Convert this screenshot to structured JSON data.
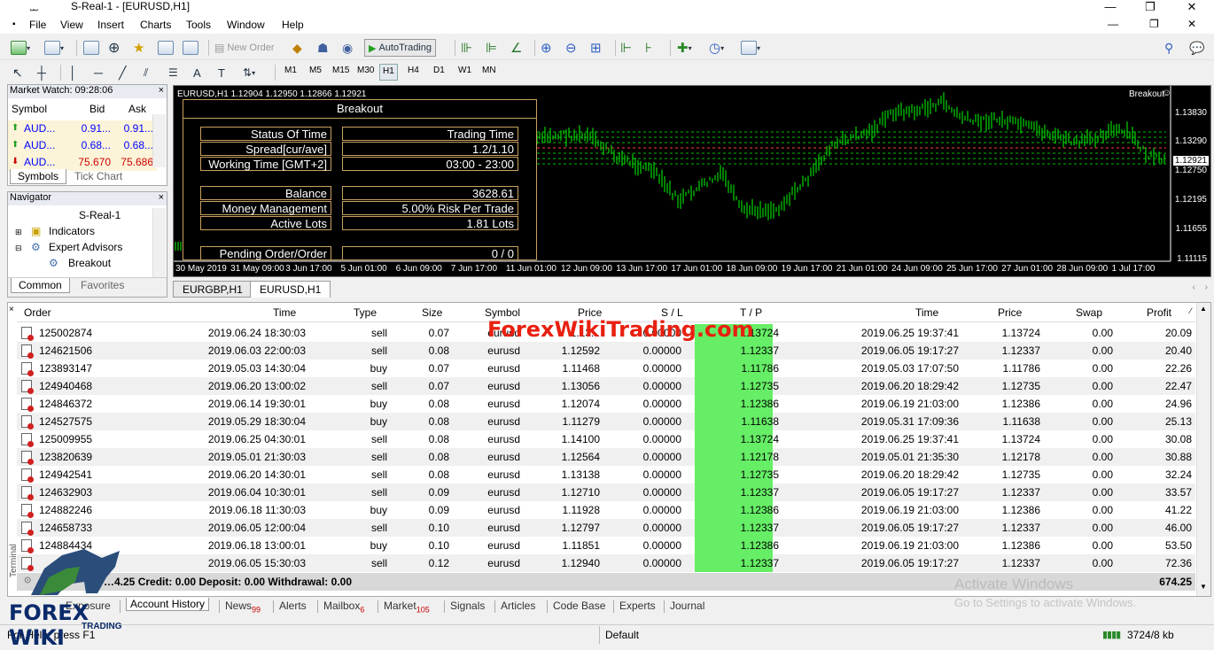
{
  "window": {
    "title": "S-Real-1 - [EURUSD,H1]",
    "icon": "mt4-icon",
    "controls": [
      "—",
      "❐",
      "✕"
    ]
  },
  "menu": [
    "File",
    "View",
    "Insert",
    "Charts",
    "Tools",
    "Window",
    "Help"
  ],
  "toolbar": {
    "new_order": "New Order",
    "autotrading": "AutoTrading"
  },
  "timeframes": [
    "M1",
    "M5",
    "M15",
    "M30",
    "H1",
    "H4",
    "D1",
    "W1",
    "MN"
  ],
  "market_watch": {
    "title": "Market Watch: 09:28:06",
    "columns": [
      "Symbol",
      "Bid",
      "Ask"
    ],
    "rows": [
      {
        "symbol": "AUD...",
        "bid": "0.91...",
        "ask": "0.91...",
        "dir": "up",
        "color": "#0000ff"
      },
      {
        "symbol": "AUD...",
        "bid": "0.68...",
        "ask": "0.68...",
        "dir": "up",
        "color": "#0000ff"
      },
      {
        "symbol": "AUD...",
        "bid": "75.670",
        "ask": "75.686",
        "dir": "down",
        "color": "#d00000"
      }
    ],
    "tabs": [
      "Symbols",
      "Tick Chart"
    ]
  },
  "navigator": {
    "title": "Navigator",
    "items": [
      "S-Real-1",
      "Indicators",
      "Expert Advisors",
      "Breakout"
    ],
    "tabs": [
      "Common",
      "Favorites"
    ]
  },
  "chart": {
    "label": "EURUSD,H1  1.12904 1.12950 1.12866 1.12921",
    "ea_name": "Breakout",
    "current_price": "1.12921",
    "price_ticks": [
      "1.13830",
      "1.13290",
      "1.12750",
      "1.12195",
      "1.11655",
      "1.11115"
    ],
    "time_ticks": [
      "30 May 2019",
      "31 May 09:00",
      "3 Jun 17:00",
      "5 Jun 01:00",
      "6 Jun 09:00",
      "7 Jun 17:00",
      "11 Jun 01:00",
      "12 Jun 09:00",
      "13 Jun 17:00",
      "17 Jun 01:00",
      "18 Jun 09:00",
      "19 Jun 17:00",
      "21 Jun 01:00",
      "24 Jun 09:00",
      "25 Jun 17:00",
      "27 Jun 01:00",
      "28 Jun 09:00",
      "1 Jul 17:00"
    ],
    "tabs": [
      "EURGBP,H1",
      "EURUSD,H1"
    ]
  },
  "ea_panel": {
    "title": "Breakout",
    "rows": [
      {
        "label": "Status Of Time",
        "value": "Trading Time"
      },
      {
        "label": "Spread[cur/ave]",
        "value": "1.2/1.10"
      },
      {
        "label": "Working Time [GMT+2]",
        "value": "03:00 - 23:00"
      },
      {
        "label": "Balance",
        "value": "3628.61"
      },
      {
        "label": "Money Management",
        "value": "5.00% Risk Per Trade"
      },
      {
        "label": "Active Lots",
        "value": "1.81 Lots"
      },
      {
        "label": "Pending Order/Order",
        "value": "0 / 0"
      }
    ]
  },
  "terminal": {
    "columns": [
      "Order",
      "Time",
      "Type",
      "Size",
      "Symbol",
      "Price",
      "S / L",
      "T / P",
      "Time",
      "Price",
      "Swap",
      "Profit"
    ],
    "rows": [
      [
        "125002874",
        "2019.06.24 18:30:03",
        "sell",
        "0.07",
        "eurusd",
        "1.13...",
        "0.00000",
        "1.13724",
        "2019.06.25 19:37:41",
        "1.13724",
        "0.00",
        "20.09"
      ],
      [
        "124621506",
        "2019.06.03 22:00:03",
        "sell",
        "0.08",
        "eurusd",
        "1.12592",
        "0.00000",
        "1.12337",
        "2019.06.05 19:17:27",
        "1.12337",
        "0.00",
        "20.40"
      ],
      [
        "123893147",
        "2019.05.03 14:30:04",
        "buy",
        "0.07",
        "eurusd",
        "1.11468",
        "0.00000",
        "1.11786",
        "2019.05.03 17:07:50",
        "1.11786",
        "0.00",
        "22.26"
      ],
      [
        "124940468",
        "2019.06.20 13:00:02",
        "sell",
        "0.07",
        "eurusd",
        "1.13056",
        "0.00000",
        "1.12735",
        "2019.06.20 18:29:42",
        "1.12735",
        "0.00",
        "22.47"
      ],
      [
        "124846372",
        "2019.06.14 19:30:01",
        "buy",
        "0.08",
        "eurusd",
        "1.12074",
        "0.00000",
        "1.12386",
        "2019.06.19 21:03:00",
        "1.12386",
        "0.00",
        "24.96"
      ],
      [
        "124527575",
        "2019.05.29 18:30:04",
        "buy",
        "0.08",
        "eurusd",
        "1.11279",
        "0.00000",
        "1.11638",
        "2019.05.31 17:09:36",
        "1.11638",
        "0.00",
        "25.13"
      ],
      [
        "125009955",
        "2019.06.25 04:30:01",
        "sell",
        "0.08",
        "eurusd",
        "1.14100",
        "0.00000",
        "1.13724",
        "2019.06.25 19:37:41",
        "1.13724",
        "0.00",
        "30.08"
      ],
      [
        "123820639",
        "2019.05.01 21:30:03",
        "sell",
        "0.08",
        "eurusd",
        "1.12564",
        "0.00000",
        "1.12178",
        "2019.05.01 21:35:30",
        "1.12178",
        "0.00",
        "30.88"
      ],
      [
        "124942541",
        "2019.06.20 14:30:01",
        "sell",
        "0.08",
        "eurusd",
        "1.13138",
        "0.00000",
        "1.12735",
        "2019.06.20 18:29:42",
        "1.12735",
        "0.00",
        "32.24"
      ],
      [
        "124632903",
        "2019.06.04 10:30:01",
        "sell",
        "0.09",
        "eurusd",
        "1.12710",
        "0.00000",
        "1.12337",
        "2019.06.05 19:17:27",
        "1.12337",
        "0.00",
        "33.57"
      ],
      [
        "124882246",
        "2019.06.18 11:30:03",
        "buy",
        "0.09",
        "eurusd",
        "1.11928",
        "0.00000",
        "1.12386",
        "2019.06.19 21:03:00",
        "1.12386",
        "0.00",
        "41.22"
      ],
      [
        "124658733",
        "2019.06.05 12:00:04",
        "sell",
        "0.10",
        "eurusd",
        "1.12797",
        "0.00000",
        "1.12337",
        "2019.06.05 19:17:27",
        "1.12337",
        "0.00",
        "46.00"
      ],
      [
        "124884434",
        "2019.06.18 13:00:01",
        "buy",
        "0.10",
        "eurusd",
        "1.11851",
        "0.00000",
        "1.12386",
        "2019.06.19 21:03:00",
        "1.12386",
        "0.00",
        "53.50"
      ],
      [
        "",
        "2019.06.05 15:30:03",
        "sell",
        "0.12",
        "eurusd",
        "1.12940",
        "0.00000",
        "1.12337",
        "2019.06.05 19:17:27",
        "1.12337",
        "0.00",
        "72.36"
      ]
    ],
    "total_text": "P…4.25  Credit: 0.00  Deposit: 0.00  Withdrawal: 0.00",
    "total_profit": "674.25",
    "side_label": "Terminal",
    "tabs": [
      {
        "label": "Exposure",
        "badge": ""
      },
      {
        "label": "Account History",
        "badge": ""
      },
      {
        "label": "News",
        "badge": "99"
      },
      {
        "label": "Alerts",
        "badge": ""
      },
      {
        "label": "Mailbox",
        "badge": "6"
      },
      {
        "label": "Market",
        "badge": "105"
      },
      {
        "label": "Signals",
        "badge": ""
      },
      {
        "label": "Articles",
        "badge": ""
      },
      {
        "label": "Code Base",
        "badge": ""
      },
      {
        "label": "Experts",
        "badge": ""
      },
      {
        "label": "Journal",
        "badge": ""
      }
    ]
  },
  "status": {
    "help": "For Help, press F1",
    "profile": "Default",
    "traffic": "3724/8 kb"
  },
  "overlays": {
    "watermark": "ForexWikiTrading.com",
    "activate_title": "Activate Windows",
    "activate_sub": "Go to Settings to activate Windows.",
    "logo_text": "FOREX WIKI",
    "logo_sub": "TRADING"
  },
  "colors": {
    "tp_green": "#66ee66",
    "candle_green": "#00ff00",
    "panel_gold": "#c8a060",
    "sell_red": "#d00000"
  }
}
